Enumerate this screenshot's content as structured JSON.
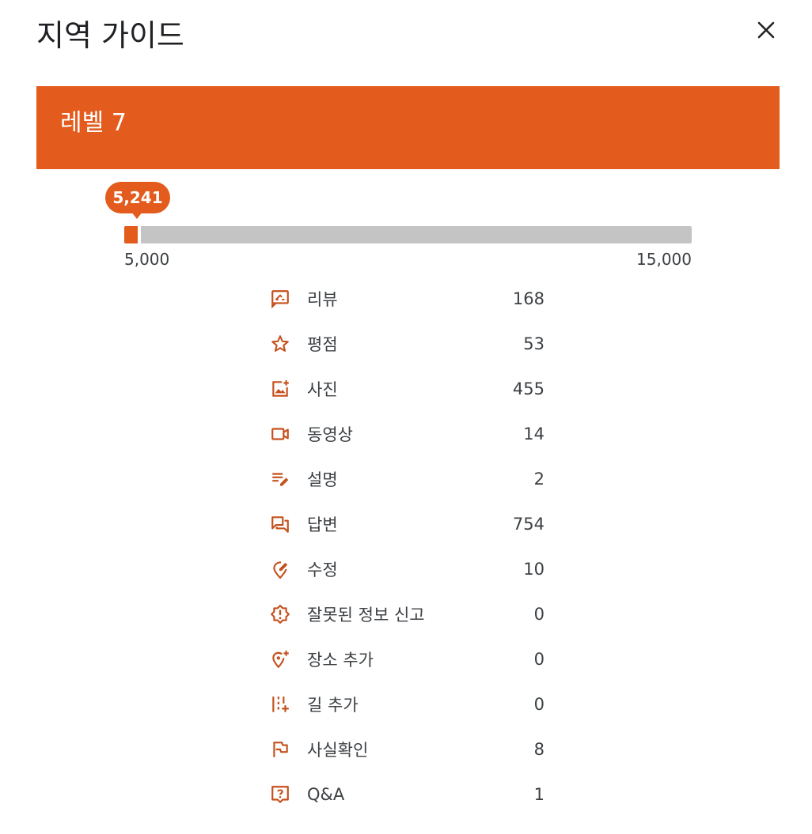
{
  "header": {
    "title": "지역 가이드",
    "close_icon": "close-icon"
  },
  "level": {
    "label": "레벨 7",
    "accent_color": "#e35b1d"
  },
  "progress": {
    "current_label": "5,241",
    "current": 5241,
    "min_label": "5,000",
    "max_label": "15,000",
    "min": 5000,
    "max": 15000
  },
  "stats": [
    {
      "icon": "review-icon",
      "label": "리뷰",
      "value": "168"
    },
    {
      "icon": "star-icon",
      "label": "평점",
      "value": "53"
    },
    {
      "icon": "add-photo-icon",
      "label": "사진",
      "value": "455"
    },
    {
      "icon": "video-icon",
      "label": "동영상",
      "value": "14"
    },
    {
      "icon": "description-edit-icon",
      "label": "설명",
      "value": "2"
    },
    {
      "icon": "answer-icon",
      "label": "답변",
      "value": "754"
    },
    {
      "icon": "edit-place-icon",
      "label": "수정",
      "value": "10"
    },
    {
      "icon": "report-icon",
      "label": "잘못된 정보 신고",
      "value": "0"
    },
    {
      "icon": "add-place-icon",
      "label": "장소 추가",
      "value": "0"
    },
    {
      "icon": "add-road-icon",
      "label": "길 추가",
      "value": "0"
    },
    {
      "icon": "flag-icon",
      "label": "사실확인",
      "value": "8"
    },
    {
      "icon": "qa-icon",
      "label": "Q&A",
      "value": "1"
    }
  ]
}
